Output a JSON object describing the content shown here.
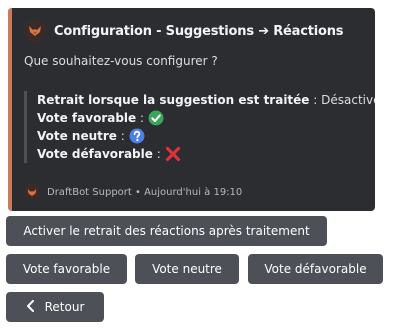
{
  "colors": {
    "embed_accent": "#cc7a5c",
    "embed_bg": "#2b2d31",
    "button_bg": "#4e5058"
  },
  "embed": {
    "author_icon": "draftbot-logo-icon",
    "author": "Configuration - Suggestions ➔ Réactions",
    "description": "Que souhaitez-vous configurer ?",
    "fields": [
      {
        "label": "Retrait lorsque la suggestion est traitée",
        "separator": " : ",
        "value": "Désactivé",
        "icon": ""
      },
      {
        "label": "Vote favorable",
        "separator": " :",
        "value": "",
        "icon": "check-mark-icon"
      },
      {
        "label": "Vote neutre",
        "separator": " :",
        "value": "",
        "icon": "question-mark-icon"
      },
      {
        "label": "Vote défavorable",
        "separator": " :",
        "value": "",
        "icon": "cross-mark-icon"
      }
    ],
    "footer": "DraftBot Support • Aujourd'hui à 19:10"
  },
  "buttons": {
    "toggle_removal": "Activer le retrait des réactions après traitement",
    "vote_favorable": "Vote favorable",
    "vote_neutre": "Vote neutre",
    "vote_defavorable": "Vote défavorable",
    "back": "Retour",
    "back_icon": "chevron-left-icon"
  }
}
